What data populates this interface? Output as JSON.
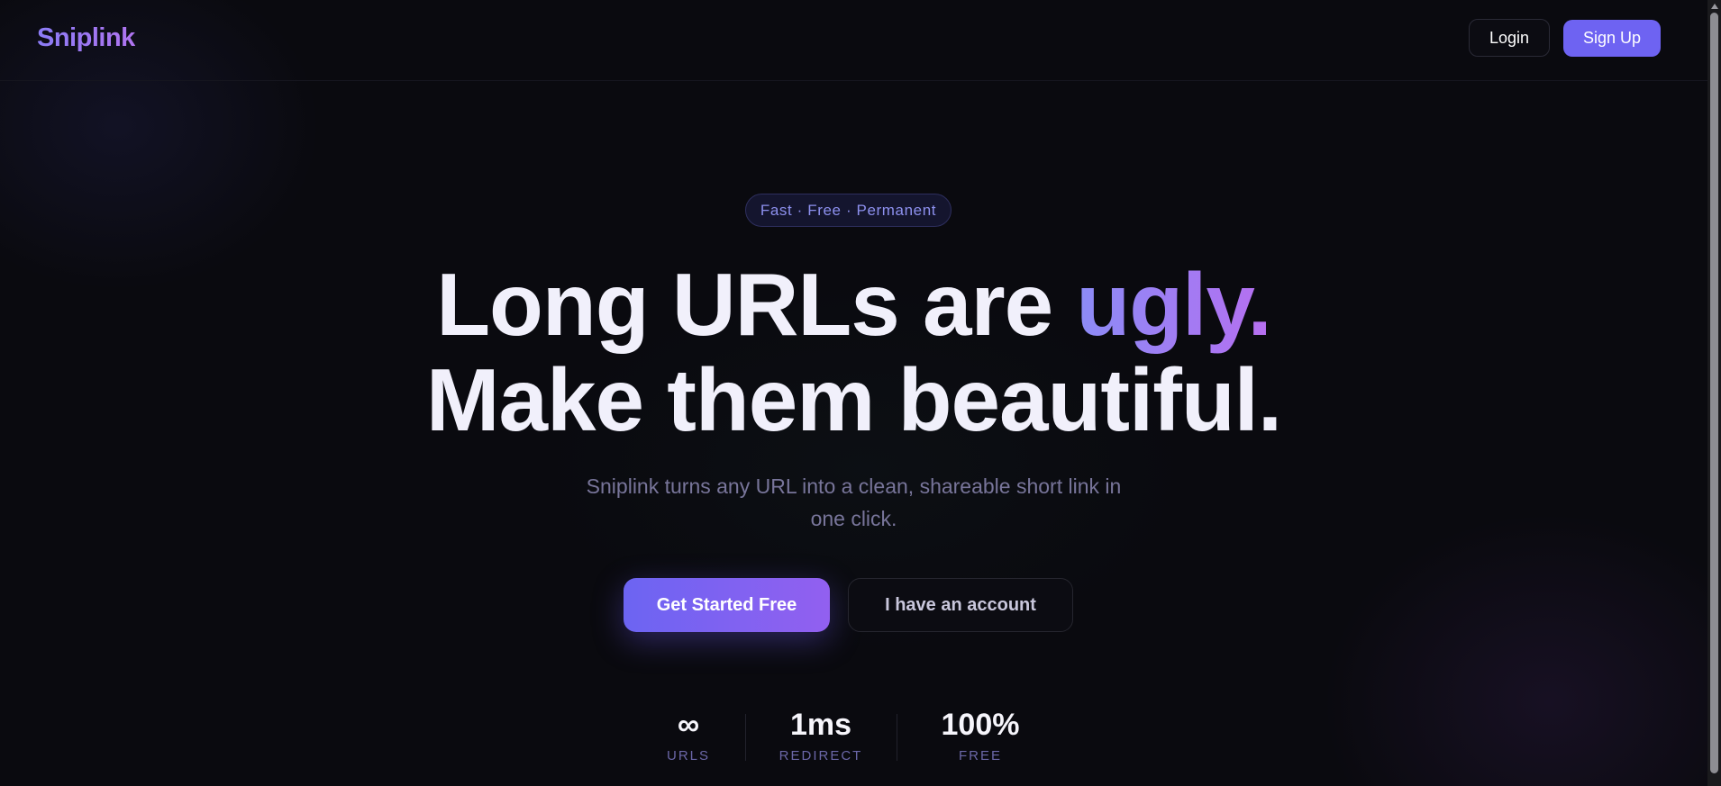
{
  "header": {
    "logo": "Sniplink",
    "login_label": "Login",
    "signup_label": "Sign Up"
  },
  "hero": {
    "badge": "Fast · Free · Permanent",
    "headline_line1": "Long URLs are ",
    "headline_accent": "ugly.",
    "headline_line2": "Make them beautiful.",
    "subtext": "Sniplink turns any URL into a clean, shareable short link in one click.",
    "primary_cta": "Get Started Free",
    "secondary_cta": "I have an account"
  },
  "stats": [
    {
      "value": "∞",
      "label": "URLS"
    },
    {
      "value": "1ms",
      "label": "REDIRECT"
    },
    {
      "value": "100%",
      "label": "FREE"
    }
  ],
  "colors": {
    "background": "#0a0a0f",
    "accent": "#6e63f2",
    "accent_gradient_end": "#9260f0",
    "text": "#f1f0fb",
    "muted": "#78759a"
  }
}
